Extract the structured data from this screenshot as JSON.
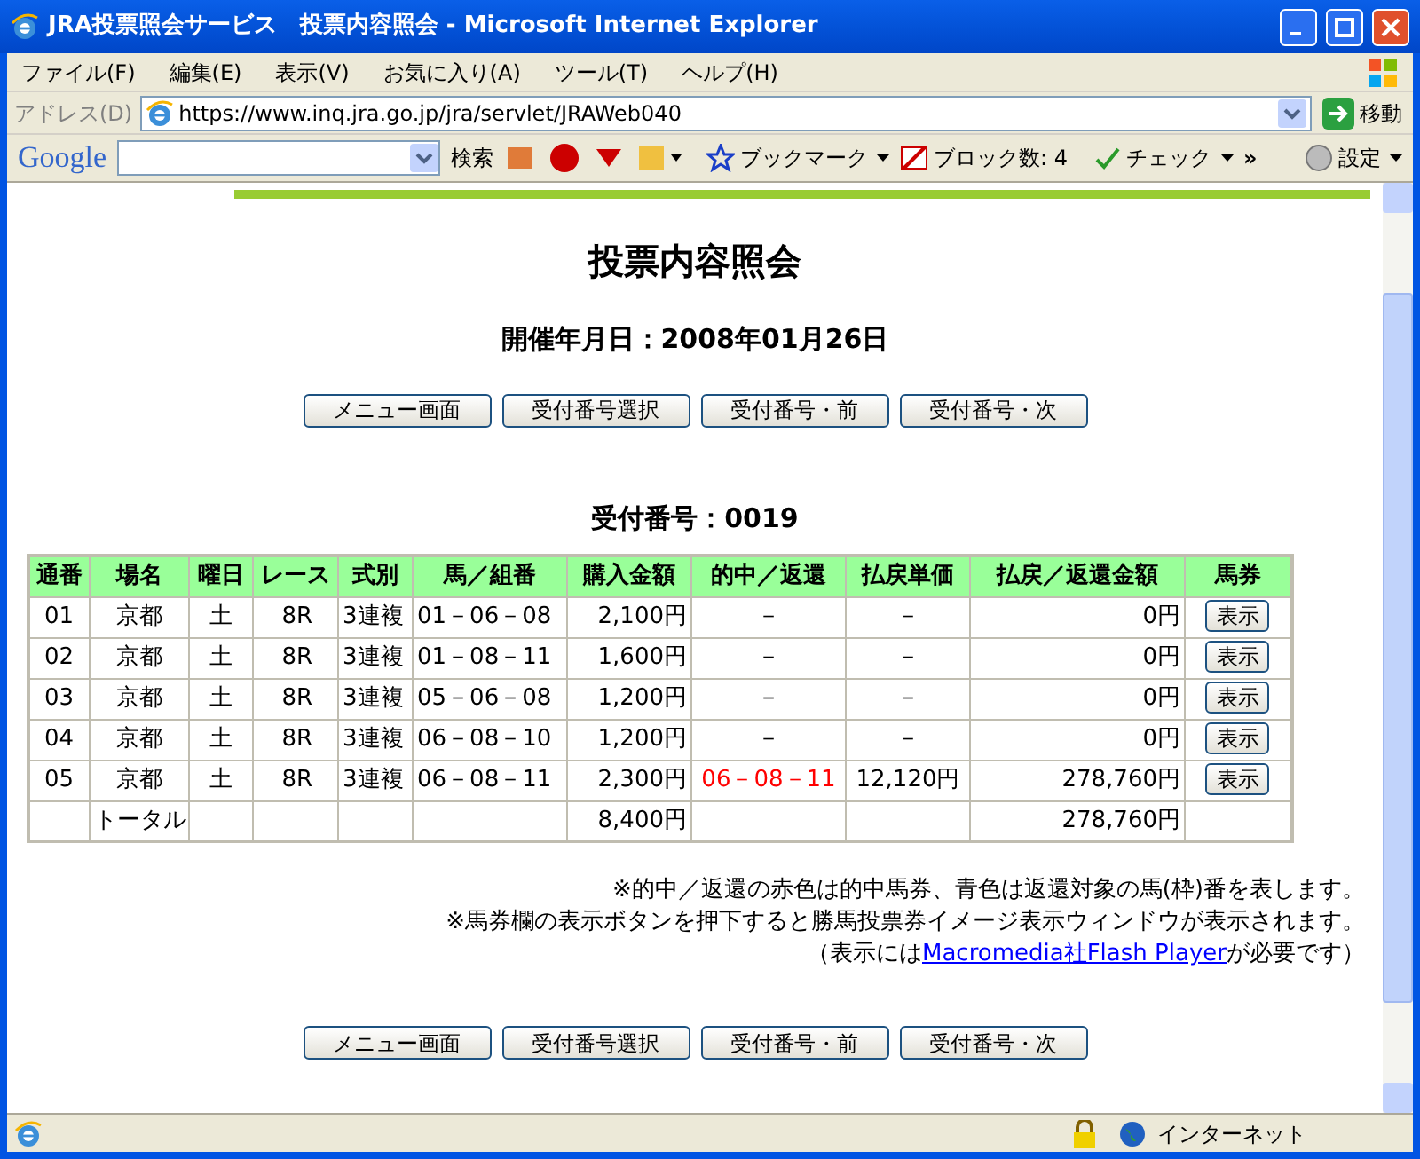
{
  "window": {
    "title": "JRA投票照会サービス　投票内容照会 - Microsoft Internet Explorer"
  },
  "menu": [
    "ファイル(F)",
    "編集(E)",
    "表示(V)",
    "お気に入り(A)",
    "ツール(T)",
    "ヘルプ(H)"
  ],
  "address_bar": {
    "label": "アドレス(D)",
    "url": "https://www.inq.jra.go.jp/jra/servlet/JRAWeb040",
    "go": "移動"
  },
  "google_toolbar": {
    "logo": "Google",
    "search": "検索",
    "bookmarks": "ブックマーク",
    "blocked": "ブロック数: 4",
    "check": "チェック",
    "more": "»",
    "settings": "設定"
  },
  "page": {
    "heading": "投票内容照会",
    "date": "開催年月日：2008年01月26日",
    "nav_buttons_top": [
      "メニュー画面",
      "受付番号選択",
      "受付番号・前",
      "受付番号・次"
    ],
    "receipt": "受付番号：0019",
    "table": {
      "columns": [
        "通番",
        "場名",
        "曜日",
        "レース",
        "式別",
        "馬／組番",
        "購入金額",
        "的中／返還",
        "払戻単価",
        "払戻／返還金額",
        "馬券"
      ],
      "rows": [
        {
          "no": "01",
          "venue": "京都",
          "day": "土",
          "race": "8R",
          "type": "3連複",
          "combo": "01－06－08",
          "amount": "2,100円",
          "result": "－",
          "hit": false,
          "unit": "－",
          "payout": "0円",
          "button": "表示"
        },
        {
          "no": "02",
          "venue": "京都",
          "day": "土",
          "race": "8R",
          "type": "3連複",
          "combo": "01－08－11",
          "amount": "1,600円",
          "result": "－",
          "hit": false,
          "unit": "－",
          "payout": "0円",
          "button": "表示"
        },
        {
          "no": "03",
          "venue": "京都",
          "day": "土",
          "race": "8R",
          "type": "3連複",
          "combo": "05－06－08",
          "amount": "1,200円",
          "result": "－",
          "hit": false,
          "unit": "－",
          "payout": "0円",
          "button": "表示"
        },
        {
          "no": "04",
          "venue": "京都",
          "day": "土",
          "race": "8R",
          "type": "3連複",
          "combo": "06－08－10",
          "amount": "1,200円",
          "result": "－",
          "hit": false,
          "unit": "－",
          "payout": "0円",
          "button": "表示"
        },
        {
          "no": "05",
          "venue": "京都",
          "day": "土",
          "race": "8R",
          "type": "3連複",
          "combo": "06－08－11",
          "amount": "2,300円",
          "result": "06－08－11",
          "hit": true,
          "unit": "12,120円",
          "payout": "278,760円",
          "button": "表示"
        }
      ],
      "total": {
        "label": "トータル",
        "amount": "8,400円",
        "payout": "278,760円"
      }
    },
    "notes": [
      "※的中／返還の赤色は的中馬券、青色は返還対象の馬(枠)番を表します。",
      "※馬券欄の表示ボタンを押下すると勝馬投票券イメージ表示ウィンドウが表示されます。"
    ],
    "flash_note": {
      "before": "（表示には",
      "link": "Macromedia社Flash Player",
      "after": "が必要です）"
    },
    "nav_buttons_bottom": [
      "メニュー画面",
      "受付番号選択",
      "受付番号・前",
      "受付番号・次"
    ]
  },
  "status_bar": {
    "zone": "インターネット"
  }
}
